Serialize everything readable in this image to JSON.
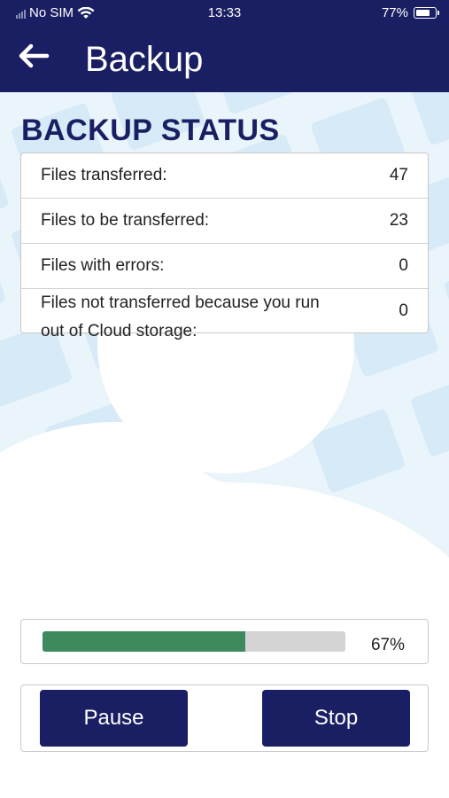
{
  "status_bar": {
    "carrier": "No SIM",
    "time": "13:33",
    "battery": "77%"
  },
  "header": {
    "back_icon": "arrow-left-icon",
    "title": "Backup"
  },
  "backup_status": {
    "title": "BACKUP STATUS",
    "rows": [
      {
        "label": "Files transferred:",
        "value": "47"
      },
      {
        "label": "Files to be transferred:",
        "value": "23"
      },
      {
        "label": "Files with errors:",
        "value": "0"
      },
      {
        "label": "Files not transferred because you run out of Cloud storage:",
        "value": "0"
      }
    ]
  },
  "progress": {
    "percent_text": "67%",
    "fraction": 0.67
  },
  "actions": {
    "pause_label": "Pause",
    "stop_label": "Stop"
  },
  "colors": {
    "primary": "#1a1f63",
    "progress": "#3d8a5e"
  }
}
